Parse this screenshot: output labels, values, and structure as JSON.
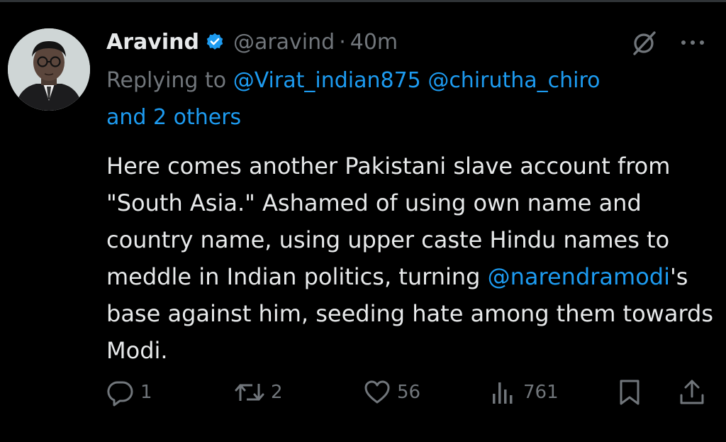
{
  "tweet": {
    "author_name": "Aravind",
    "author_handle": "@aravind",
    "separator": "·",
    "time": "40m",
    "replying_prefix": "Replying to",
    "reply_handle_1": "@Virat_indian875",
    "reply_handle_2": "@chirutha_chiro",
    "reply_others": "and 2 others",
    "text_part1": "Here comes another Pakistani slave account from \"South Asia.\" Ashamed of using own name and country name, using upper caste Hindu names to meddle in Indian politics, turning ",
    "mention": "@narendramodi",
    "text_part2": "'s base against him, seeding hate among them towards Modi."
  },
  "actions": {
    "replies": "1",
    "reposts": "2",
    "likes": "56",
    "views": "761"
  },
  "icons": {
    "verified": "verified-badge-icon",
    "grok": "grok-icon",
    "more": "more-icon",
    "reply": "reply-icon",
    "repost": "repost-icon",
    "like": "heart-icon",
    "views": "views-icon",
    "bookmark": "bookmark-icon",
    "share": "share-icon"
  },
  "colors": {
    "background": "#000000",
    "text": "#e7e9ea",
    "muted": "#71767b",
    "link": "#1d9bf0"
  }
}
